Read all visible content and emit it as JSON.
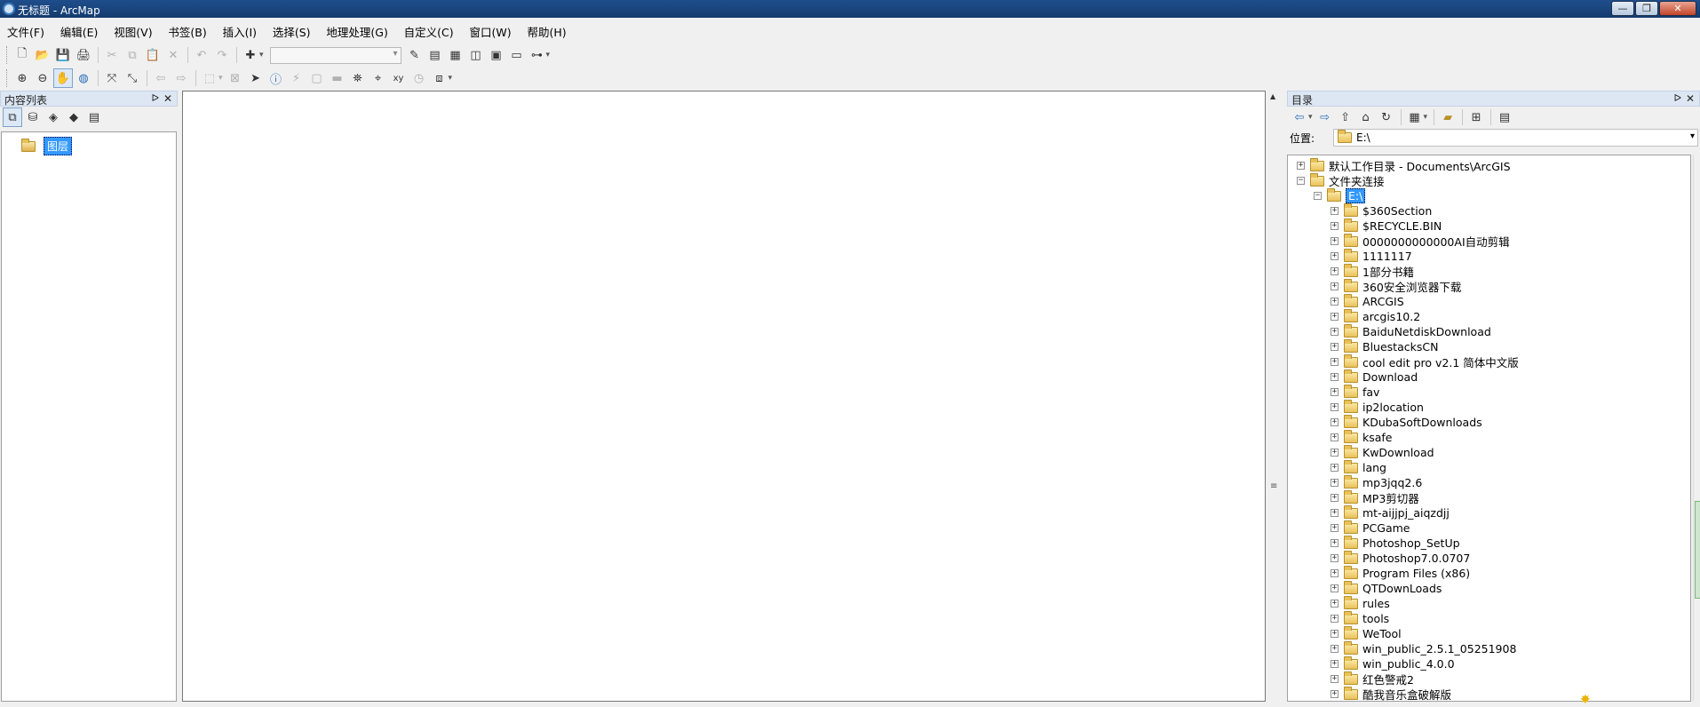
{
  "window": {
    "title": "无标题 - ArcMap",
    "minimize": "—",
    "maximize": "❐",
    "close": "✕"
  },
  "menu": [
    "文件(F)",
    "编辑(E)",
    "视图(V)",
    "书签(B)",
    "插入(I)",
    "选择(S)",
    "地理处理(G)",
    "自定义(C)",
    "窗口(W)",
    "帮助(H)"
  ],
  "toc": {
    "title": "内容列表",
    "pin": "ᐅ",
    "close": "✕",
    "layers_label": "图层"
  },
  "catalog": {
    "title": "目录",
    "location_label": "位置:",
    "location_value": "E:\\",
    "nodes": [
      {
        "label": "默认工作目录 - Documents\\ArcGIS",
        "expander": "+"
      },
      {
        "label": "文件夹连接",
        "expander": "−"
      },
      {
        "label": "E:\\",
        "expander": "−"
      }
    ],
    "folders": [
      "$360Section",
      "$RECYCLE.BIN",
      "0000000000000AI自动剪辑",
      "1111117",
      "1部分书籍",
      "360安全浏览器下载",
      "ARCGIS",
      "arcgis10.2",
      "BaiduNetdiskDownload",
      "BluestacksCN",
      "cool edit pro v2.1 简体中文版",
      "Download",
      "fav",
      "ip2location",
      "KDubaSoftDownloads",
      "ksafe",
      "KwDownload",
      "lang",
      "mp3jqq2.6",
      "MP3剪切器",
      "mt-aijjpj_aiqzdjj",
      "PCGame",
      "Photoshop_SetUp",
      "Photoshop7.0.0707",
      "Program Files (x86)",
      "QTDownLoads",
      "rules",
      "tools",
      "WeTool",
      "win_public_2.5.1_05251908",
      "win_public_4.0.0",
      "红色警戒2",
      "酷我音乐盒破解版"
    ]
  },
  "icons": {
    "new": "🗋",
    "open": "📂",
    "save": "💾",
    "print": "🖨",
    "cut": "✂",
    "copy": "⧉",
    "paste": "📋",
    "delete": "✕",
    "undo": "↶",
    "redo": "↷",
    "add_data": "✚",
    "zoom_in": "⊕",
    "zoom_out": "⊖",
    "pan": "✋",
    "globe": "◍",
    "fixed_in": "⤧",
    "fixed_out": "⤡",
    "back": "⇦",
    "forward": "⇨",
    "select": "➤",
    "identify": "ⓘ",
    "find": "⛯",
    "xy": "xy"
  }
}
